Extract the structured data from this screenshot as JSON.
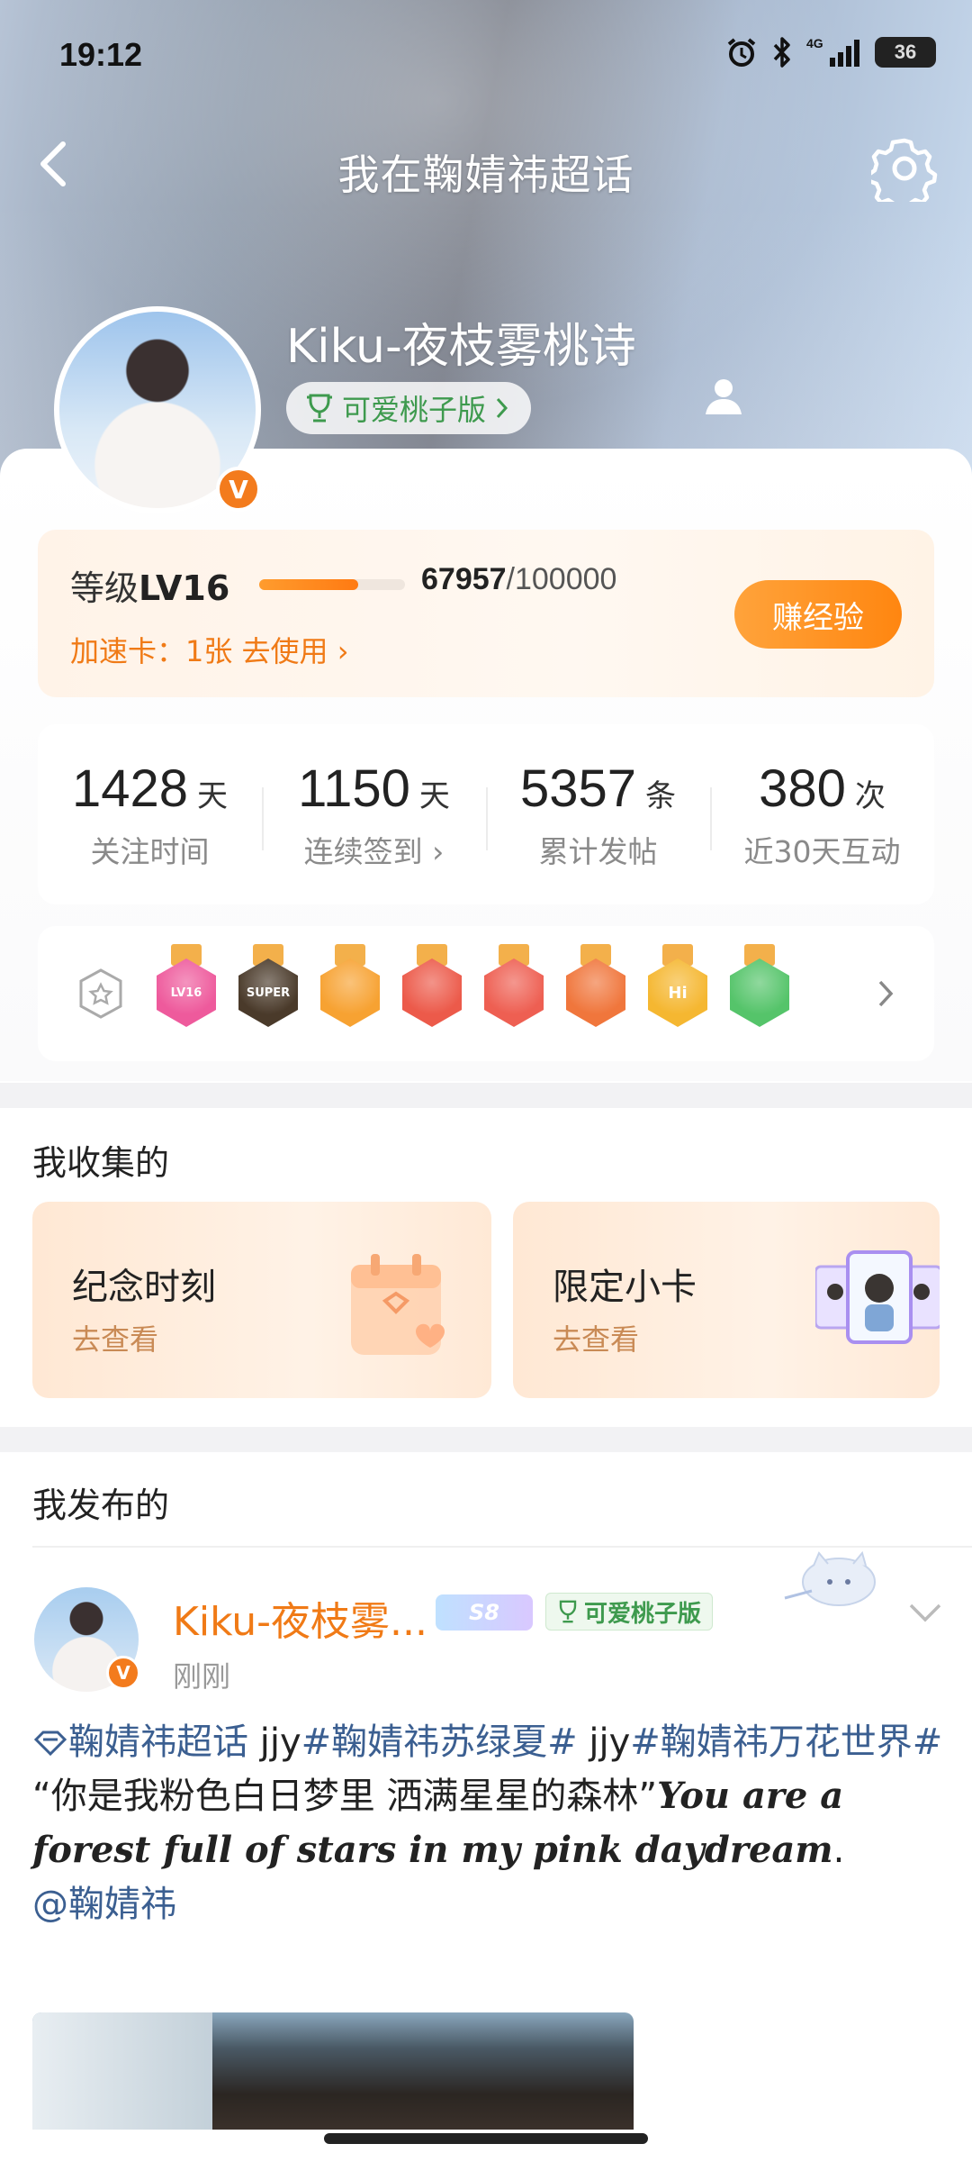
{
  "status_bar": {
    "time": "19:12",
    "network": "4G",
    "battery": "36"
  },
  "nav": {
    "title": "我在鞠婧祎超话"
  },
  "profile": {
    "name": "Kiku-夜枝雾桃诗",
    "tag": "可爱桃子版",
    "verify_badge": "V"
  },
  "level": {
    "label_prefix": "等级",
    "level": "LV16",
    "current": "67957",
    "total": "/100000",
    "progress": 0.67957,
    "speed_card": "加速卡：1张 去使用",
    "earn_button": "赚经验"
  },
  "stats": [
    {
      "value": "1428",
      "unit": "天",
      "label": "关注时间"
    },
    {
      "value": "1150",
      "unit": "天",
      "label": "连续签到 ›"
    },
    {
      "value": "5357",
      "unit": "条",
      "label": "累计发帖"
    },
    {
      "value": "380",
      "unit": "次",
      "label": "近30天互动"
    }
  ],
  "medals": [
    {
      "icon": "lv16-medal-icon",
      "text": "LV16",
      "color": "#ee5a9c"
    },
    {
      "icon": "super-crown-medal-icon",
      "text": "SUPER",
      "color": "#4a3a2a"
    },
    {
      "icon": "crown-medal-icon",
      "text": "",
      "color": "#f7a232"
    },
    {
      "icon": "cat-medal-red-icon",
      "text": "",
      "color": "#ec5a4a"
    },
    {
      "icon": "cat-medal-red-2-icon",
      "text": "",
      "color": "#ee5f52"
    },
    {
      "icon": "fox-medal-icon",
      "text": "",
      "color": "#f0763c"
    },
    {
      "icon": "hi-medal-icon",
      "text": "Hi",
      "color": "#f5b731"
    },
    {
      "icon": "hand-medal-green-icon",
      "text": "",
      "color": "#55c46a"
    }
  ],
  "collection": {
    "title": "我收集的",
    "cards": [
      {
        "title": "纪念时刻",
        "sub": "去查看"
      },
      {
        "title": "限定小卡",
        "sub": "去查看"
      }
    ]
  },
  "published": {
    "title": "我发布的"
  },
  "post": {
    "author": "Kiku-夜枝雾...",
    "level_badge": "S8",
    "tag": "可爱桃子版",
    "time": "刚刚",
    "topic1": "鞠婧祎超话",
    "text1": " jjy",
    "topic2": "#鞠婧祎苏绿夏#",
    "text2": " jjy",
    "topic3": "#鞠婧祎万花世界#",
    "quote_cn": "“你是我粉色白日梦里 洒满星星的森林”",
    "quote_en": "You are a forest full of stars in my pink daydream",
    "quote_end": ".",
    "mention": "@鞠婧祎"
  },
  "colors": {
    "accent": "#f07a16",
    "topic": "#3b5f91",
    "green_tag": "#3e9a4e"
  }
}
